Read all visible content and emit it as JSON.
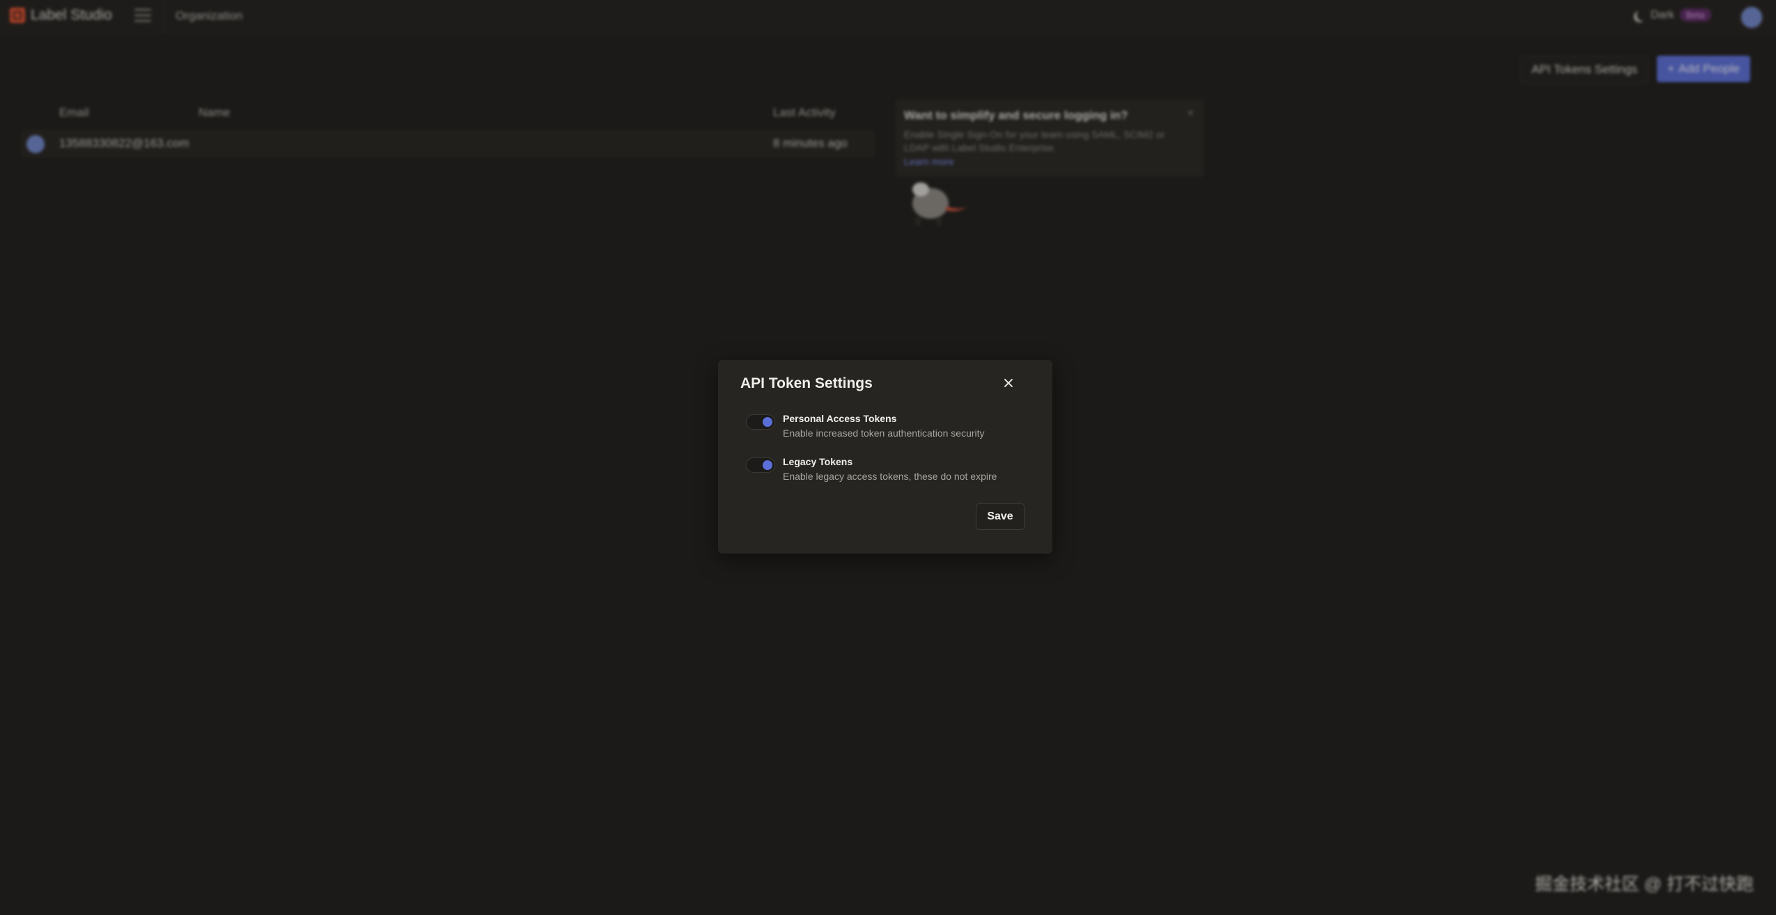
{
  "app": {
    "name": "Label Studio",
    "breadcrumb": "Organization"
  },
  "theme": {
    "label": "Dark",
    "badge": "Beta"
  },
  "actions": {
    "api_tokens_settings": "API Tokens Settings",
    "add_people": "Add People"
  },
  "table": {
    "headers": {
      "email": "Email",
      "name": "Name",
      "last_activity": "Last Activity"
    },
    "rows": [
      {
        "email": "13588330822@163.com",
        "name": "",
        "last_activity": "8 minutes ago"
      }
    ]
  },
  "sso": {
    "title": "Want to simplify and secure logging in?",
    "body": "Enable Single Sign-On for your team using SAML, SCIM2 or LDAP with Label Studio Enterprise.",
    "link": "Learn more",
    "close": "×"
  },
  "modal": {
    "title": "API Token Settings",
    "options": [
      {
        "title": "Personal Access Tokens",
        "description": "Enable increased token authentication security",
        "enabled": true
      },
      {
        "title": "Legacy Tokens",
        "description": "Enable legacy access tokens, these do not expire",
        "enabled": true
      }
    ],
    "save": "Save"
  },
  "watermark": "掘金技术社区 @ 打不过快跑",
  "colors": {
    "accent": "#5b6fd8",
    "background": "#1f1e1b",
    "logo": "#e0502f"
  }
}
